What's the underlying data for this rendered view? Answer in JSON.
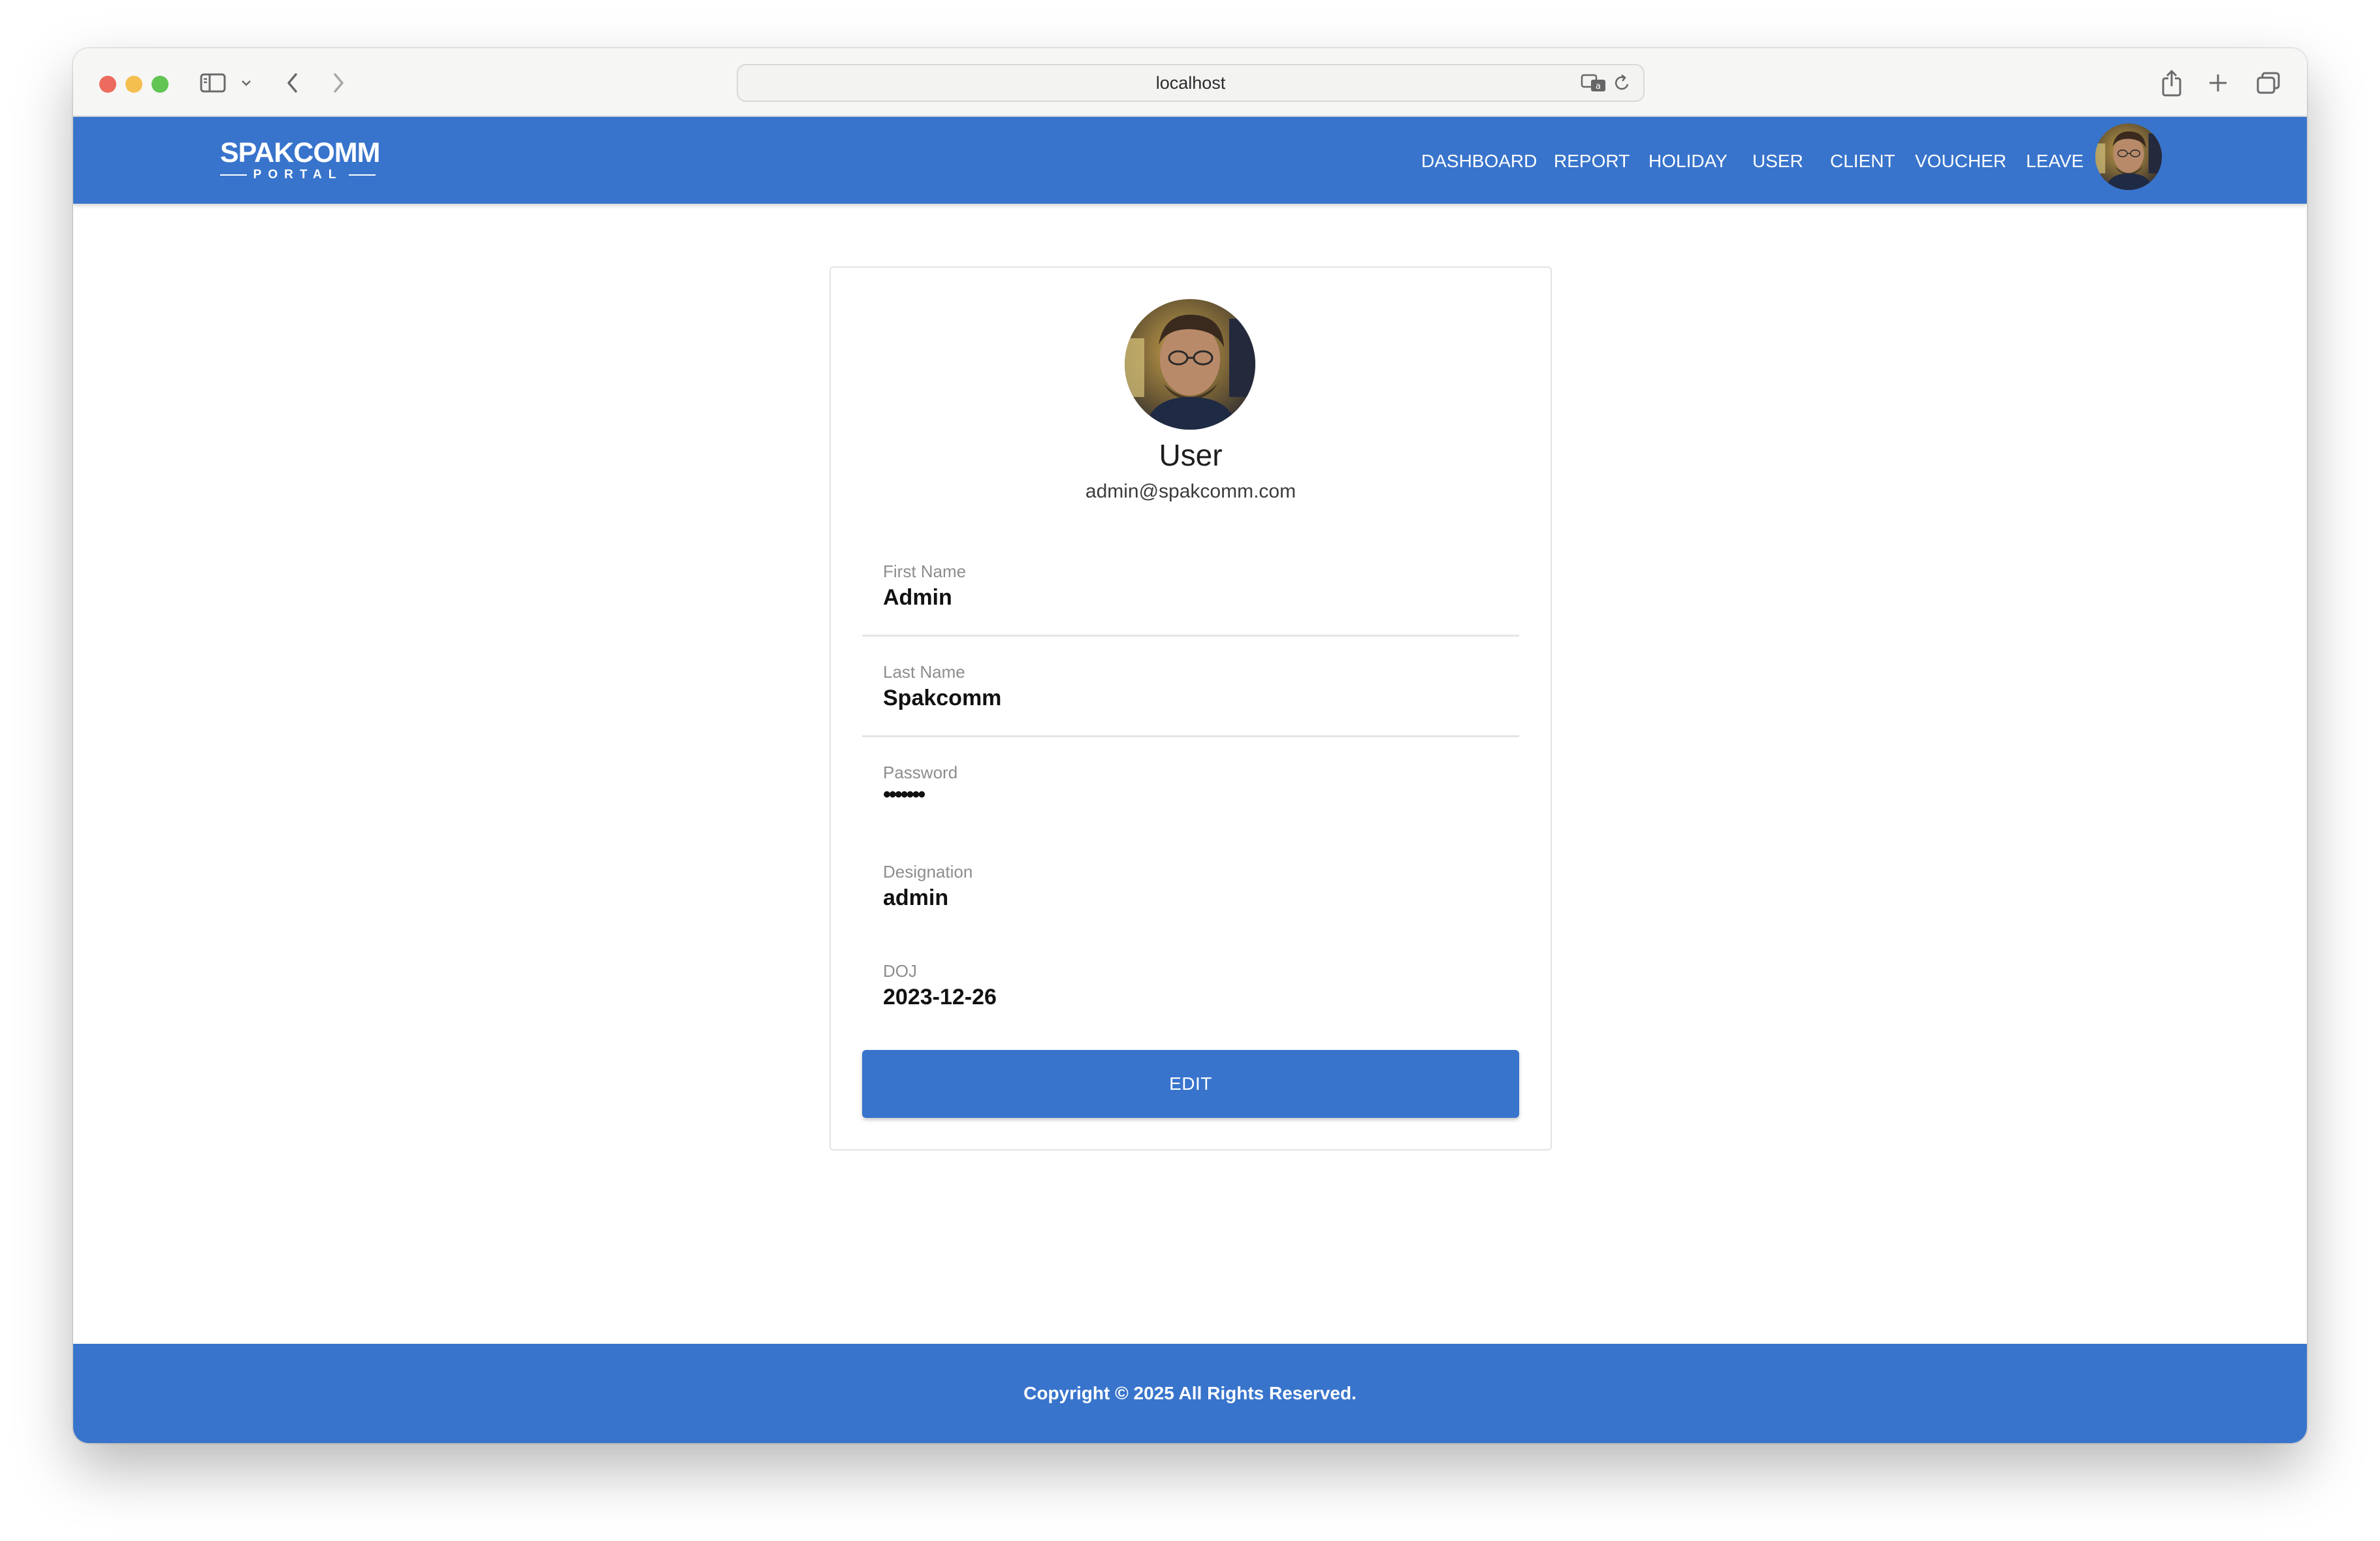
{
  "browser": {
    "url": "localhost"
  },
  "header": {
    "logo_main": "SPAKCOMM",
    "logo_sub": "PORTAL",
    "nav": [
      "DASHBOARD",
      "REPORT",
      "HOLIDAY",
      "USER",
      "CLIENT",
      "VOUCHER",
      "LEAVE"
    ]
  },
  "profile": {
    "name": "User",
    "email": "admin@spakcomm.com",
    "fields": [
      {
        "label": "First Name",
        "value": "Admin"
      },
      {
        "label": "Last Name",
        "value": "Spakcomm"
      },
      {
        "label": "Password",
        "value": "•••••••"
      },
      {
        "label": "Designation",
        "value": "admin"
      },
      {
        "label": "DOJ",
        "value": "2023-12-26"
      }
    ],
    "edit_label": "EDIT"
  },
  "footer": {
    "copyright": "Copyright © 2025 All Rights Reserved."
  },
  "colors": {
    "primary": "#3874cc"
  }
}
